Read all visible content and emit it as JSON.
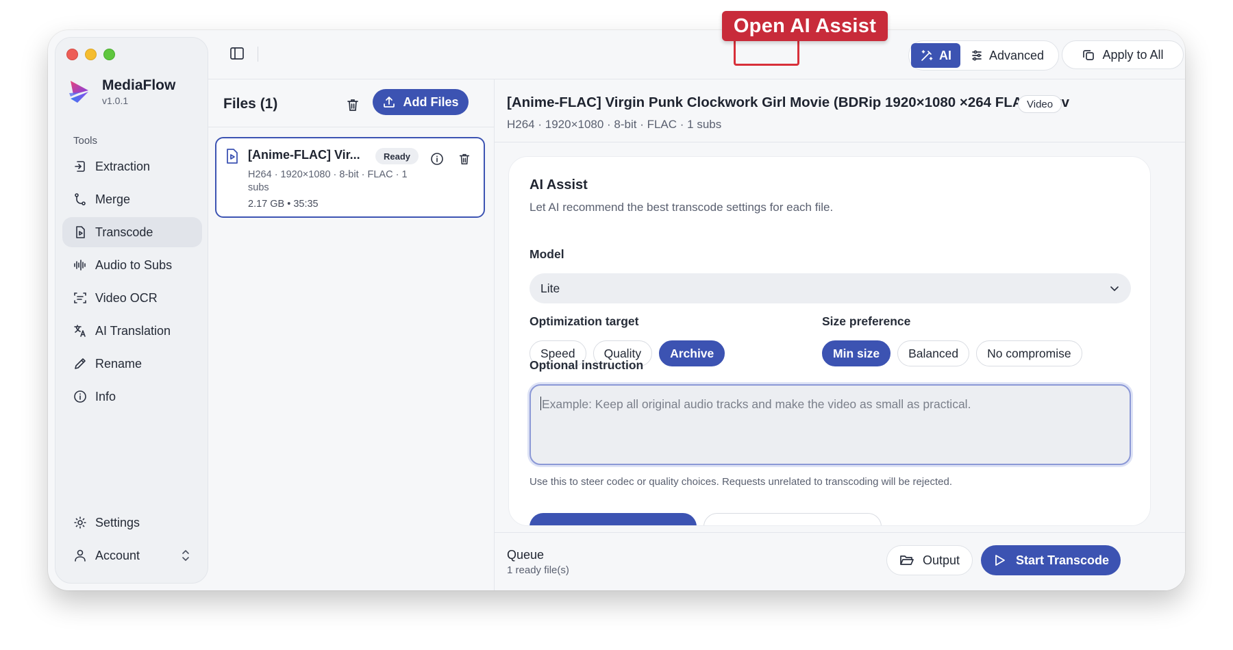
{
  "app": {
    "name": "MediaFlow",
    "version": "v1.0.1"
  },
  "sidebar": {
    "section_label": "Tools",
    "items": [
      {
        "label": "Extraction",
        "icon": "extraction-icon"
      },
      {
        "label": "Merge",
        "icon": "merge-icon"
      },
      {
        "label": "Transcode",
        "icon": "transcode-icon",
        "active": true
      },
      {
        "label": "Audio to Subs",
        "icon": "audio-waveform-icon"
      },
      {
        "label": "Video OCR",
        "icon": "ocr-scan-icon"
      },
      {
        "label": "AI Translation",
        "icon": "translate-icon"
      },
      {
        "label": "Rename",
        "icon": "pencil-icon"
      },
      {
        "label": "Info",
        "icon": "info-icon"
      }
    ],
    "bottom": [
      {
        "label": "Settings",
        "icon": "gear-icon"
      },
      {
        "label": "Account",
        "icon": "user-icon"
      }
    ]
  },
  "toolbar": {
    "mode_ai": "AI",
    "mode_advanced": "Advanced",
    "apply_to_all": "Apply to All",
    "callout": "Open AI Assist"
  },
  "files": {
    "title": "Files (1)",
    "add_label": "Add Files",
    "items": [
      {
        "name": "[Anime-FLAC] Vir...",
        "status": "Ready",
        "meta": "H264 · 1920×1080 · 8-bit · FLAC · 1 subs",
        "size": "2.17 GB  • 35:35"
      }
    ]
  },
  "detail": {
    "title": "[Anime-FLAC] Virgin Punk Clockwork Girl Movie (BDRip 1920×1080 ×264 FLAC).mkv",
    "type_badge": "Video",
    "meta": "H264 · 1920×1080 · 8-bit · FLAC · 1 subs"
  },
  "ai_assist": {
    "title": "AI Assist",
    "subtitle": "Let AI recommend the best transcode settings for each file.",
    "model_label": "Model",
    "model_value": "Lite",
    "optimization_label": "Optimization target",
    "optimization_options": [
      "Speed",
      "Quality",
      "Archive"
    ],
    "optimization_selected": "Archive",
    "size_label": "Size preference",
    "size_options": [
      "Min size",
      "Balanced",
      "No compromise"
    ],
    "size_selected": "Min size",
    "instruction_label": "Optional instruction",
    "instruction_placeholder": "Example: Keep all original audio tracks and make the video as small as practical.",
    "instruction_hint": "Use this to steer codec or quality choices. Requests unrelated to transcoding will be rejected."
  },
  "queue": {
    "title": "Queue",
    "status": "1 ready file(s)",
    "output_label": "Output",
    "start_label": "Start Transcode"
  },
  "colors": {
    "accent": "#3c53b2",
    "callout": "#c82b3a"
  }
}
